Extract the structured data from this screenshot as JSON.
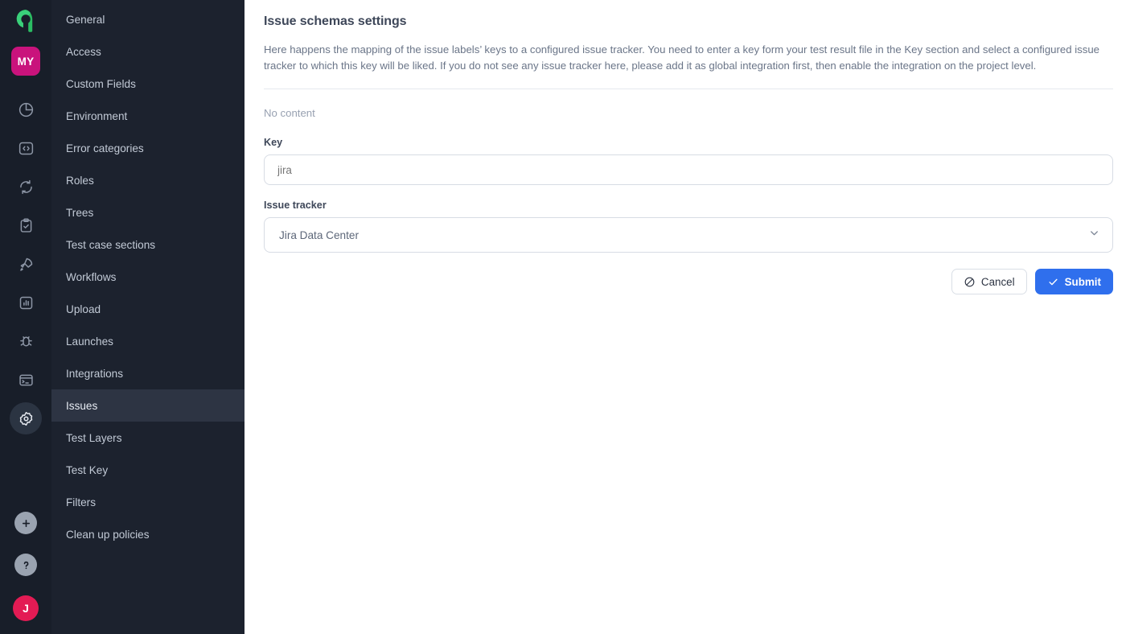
{
  "rail": {
    "logo_name": "allure-logo",
    "project_badge": "MY",
    "nav_icons": [
      {
        "name": "dashboard-pie-icon",
        "label": "Dashboards"
      },
      {
        "name": "code-brackets-icon",
        "label": "API"
      },
      {
        "name": "refresh-cycle-icon",
        "label": "Jobs"
      },
      {
        "name": "clipboard-check-icon",
        "label": "Test cases"
      },
      {
        "name": "rocket-icon",
        "label": "Launches"
      },
      {
        "name": "bar-chart-icon",
        "label": "Analytics"
      },
      {
        "name": "bug-icon",
        "label": "Defects"
      },
      {
        "name": "terminal-icon",
        "label": "Console"
      },
      {
        "name": "gear-icon",
        "label": "Settings"
      }
    ],
    "bottom_icons": [
      {
        "name": "plus-icon",
        "label": "Add"
      },
      {
        "name": "help-question-icon",
        "label": "Help"
      }
    ],
    "avatar_initial": "J",
    "colors": {
      "rail_bg": "#181e29",
      "project_badge_bg": "#c9137c",
      "avatar_bg": "#e31b54",
      "active_icon_bg": "#2b3442"
    }
  },
  "sidebar": {
    "active_index": 12,
    "items": [
      {
        "label": "General"
      },
      {
        "label": "Access"
      },
      {
        "label": "Custom Fields"
      },
      {
        "label": "Environment"
      },
      {
        "label": "Error categories"
      },
      {
        "label": "Roles"
      },
      {
        "label": "Trees"
      },
      {
        "label": "Test case sections"
      },
      {
        "label": "Workflows"
      },
      {
        "label": "Upload"
      },
      {
        "label": "Launches"
      },
      {
        "label": "Integrations"
      },
      {
        "label": "Issues"
      },
      {
        "label": "Test Layers"
      },
      {
        "label": "Test Key"
      },
      {
        "label": "Filters"
      },
      {
        "label": "Clean up policies"
      }
    ]
  },
  "main": {
    "title": "Issue schemas settings",
    "description": "Here happens the mapping of the issue labels’ keys to a configured issue tracker. You need to enter a key form your test result file in the Key section and select a configured issue tracker to which this key will be liked. If you do not see any issue tracker here, please add it as global integration first, then enable the integration on the project level.",
    "empty_state": "No content",
    "fields": {
      "key": {
        "label": "Key",
        "value": "",
        "placeholder": "jira"
      },
      "issue_tracker": {
        "label": "Issue tracker",
        "selected": "Jira Data Center",
        "options": [
          "Jira Data Center"
        ]
      }
    },
    "actions": {
      "cancel_label": "Cancel",
      "submit_label": "Submit",
      "submit_color": "#2f6fed"
    }
  }
}
